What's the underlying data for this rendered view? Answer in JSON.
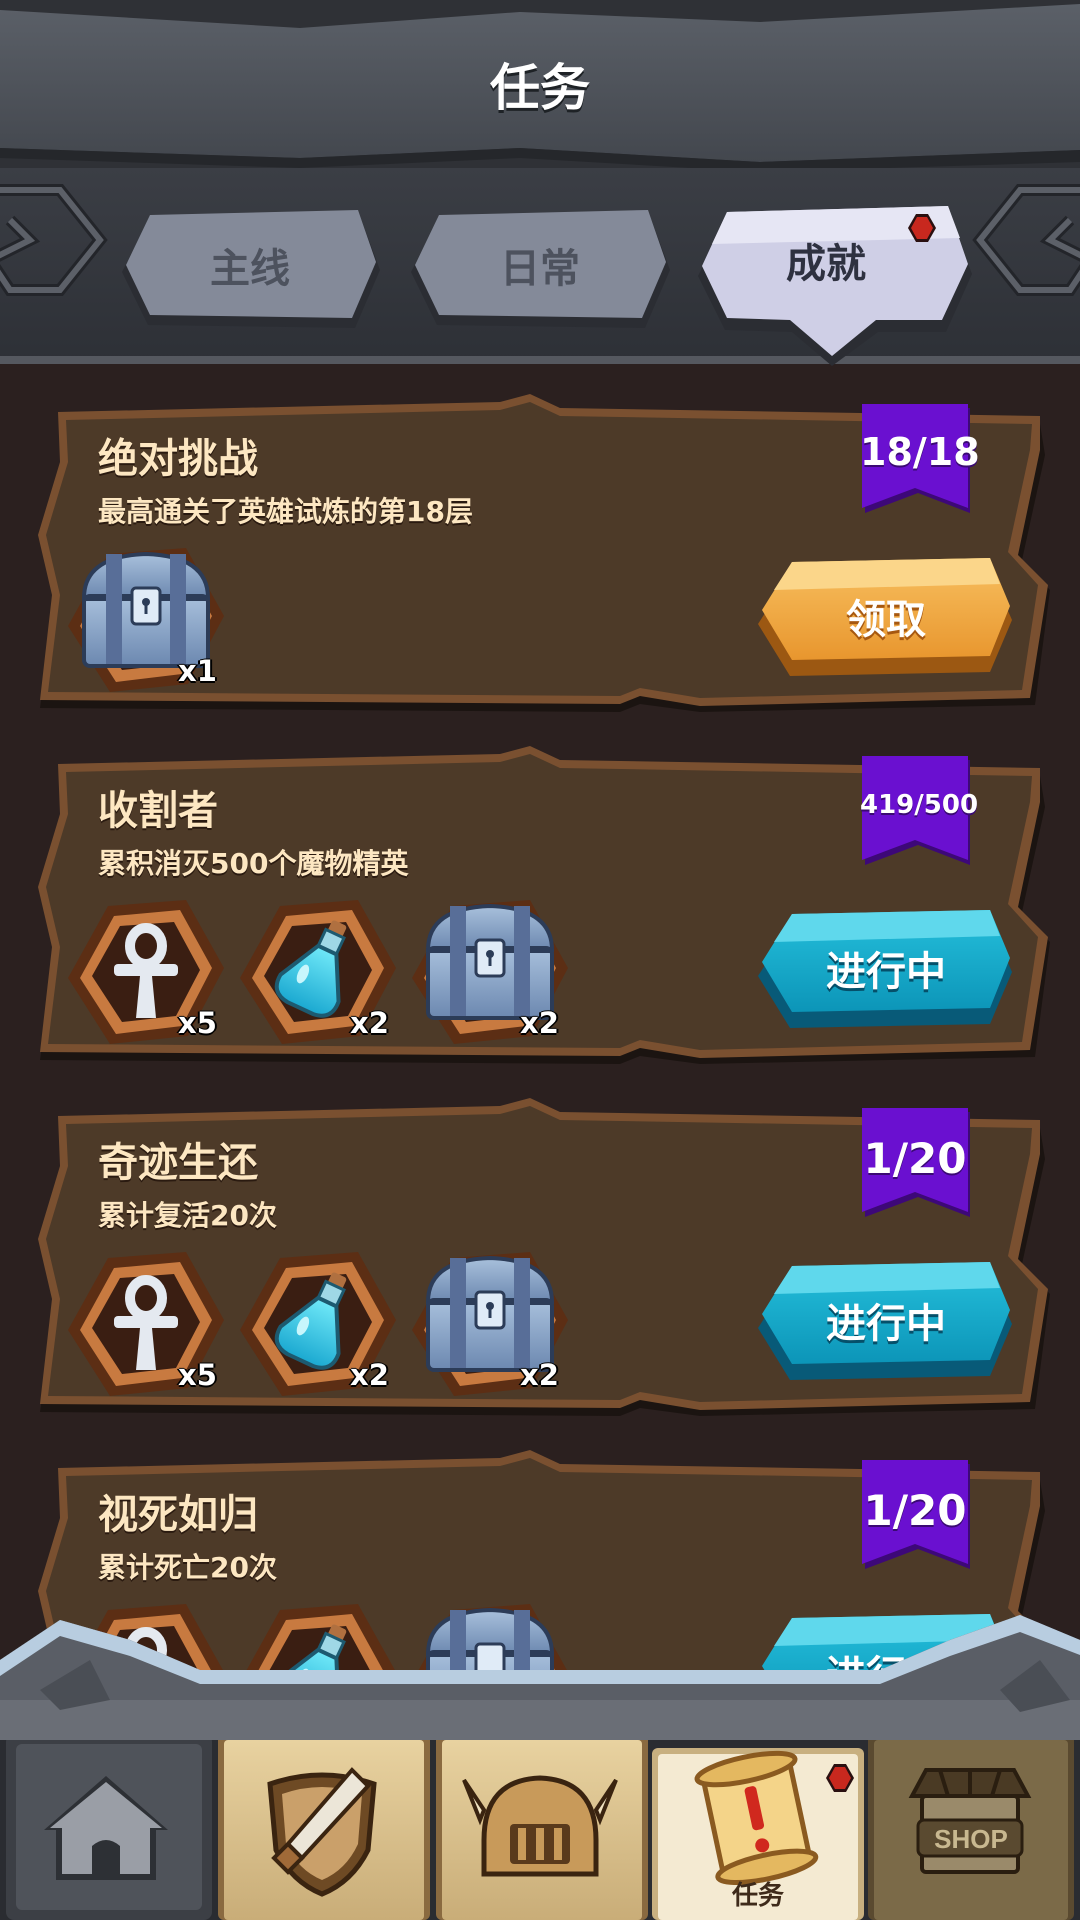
{
  "header": {
    "title": "任务"
  },
  "tabs": [
    {
      "label": "主线",
      "active": false
    },
    {
      "label": "日常",
      "active": false
    },
    {
      "label": "成就",
      "active": true,
      "has_notification": true
    }
  ],
  "quests": [
    {
      "title": "绝对挑战",
      "description": "最高通关了英雄试炼的第18层",
      "progress": "18/18",
      "rewards": [
        {
          "icon": "chest-icon",
          "qty": "x1"
        }
      ],
      "button": {
        "label": "领取",
        "state": "claim"
      }
    },
    {
      "title": "收割者",
      "description": "累积消灭500个魔物精英",
      "progress": "419/500",
      "rewards": [
        {
          "icon": "ankh-icon",
          "qty": "x5"
        },
        {
          "icon": "potion-icon",
          "qty": "x2"
        },
        {
          "icon": "chest-icon",
          "qty": "x2"
        }
      ],
      "button": {
        "label": "进行中",
        "state": "in_progress"
      }
    },
    {
      "title": "奇迹生还",
      "description": "累计复活20次",
      "progress": "1/20",
      "rewards": [
        {
          "icon": "ankh-icon",
          "qty": "x5"
        },
        {
          "icon": "potion-icon",
          "qty": "x2"
        },
        {
          "icon": "chest-icon",
          "qty": "x2"
        }
      ],
      "button": {
        "label": "进行中",
        "state": "in_progress"
      }
    },
    {
      "title": "视死如归",
      "description": "累计死亡20次",
      "progress": "1/20",
      "rewards": [
        {
          "icon": "ankh-icon",
          "qty": ""
        },
        {
          "icon": "potion-icon",
          "qty": ""
        },
        {
          "icon": "chest-icon",
          "qty": ""
        }
      ],
      "button": {
        "label": "进行中",
        "state": "in_progress"
      }
    }
  ],
  "bottom_nav": [
    {
      "icon": "home-icon",
      "label": "",
      "active": false
    },
    {
      "icon": "sword-shield-icon",
      "label": "",
      "active": false
    },
    {
      "icon": "helmet-icon",
      "label": "",
      "active": false
    },
    {
      "icon": "scroll-quest-icon",
      "label": "任务",
      "active": true,
      "has_notification": true
    },
    {
      "icon": "shop-icon",
      "label": "",
      "active": false,
      "badge_text": "SHOP"
    }
  ],
  "colors": {
    "background": "#2b201f",
    "card": "#4d3a28",
    "card_border": "#7a5030",
    "ribbon": "#6a10d0",
    "claim_button": "#f0a038",
    "progress_button": "#12a8c8",
    "title_text": "#fde7c2"
  }
}
